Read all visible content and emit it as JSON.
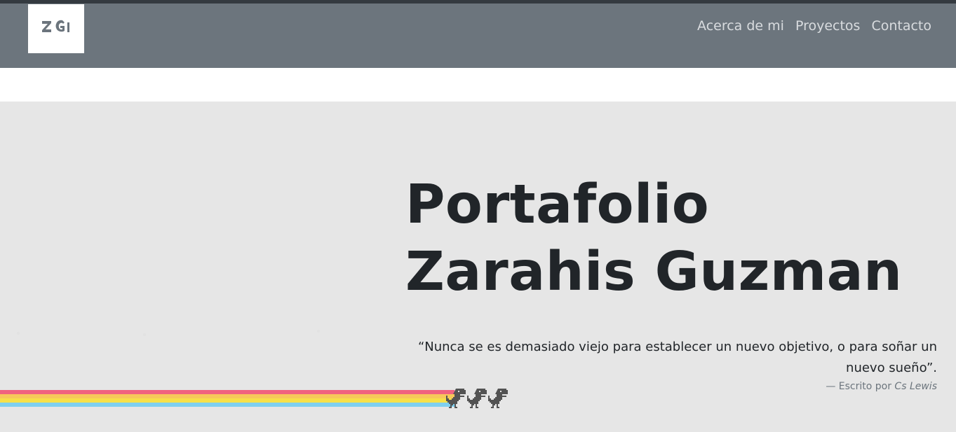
{
  "header": {
    "logo_text": "ZG",
    "nav": [
      {
        "label": "Acerca de mi"
      },
      {
        "label": "Proyectos"
      },
      {
        "label": "Contacto"
      }
    ]
  },
  "hero": {
    "title_line1": "Portafolio",
    "title_line2": "Zarahis Guzman",
    "quote": "“Nunca se es demasiado viejo para establecer un nuevo objetivo, o para soñar un nuevo sueño”.",
    "cite_prefix": "— Escrito por",
    "cite_author": "Cs Lewis"
  },
  "icons": {
    "dino": "dinosaur-icon",
    "rainbow": "rainbow-trail"
  },
  "colors": {
    "navbar": "#6c757d",
    "hero_bg": "#e6e6e6",
    "rainbow": [
      "#f0637f",
      "#f7c85a",
      "#f6e04a",
      "#7ed0f0"
    ]
  }
}
